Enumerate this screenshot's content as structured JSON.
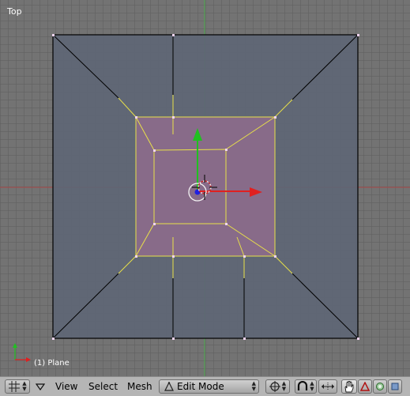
{
  "viewport": {
    "view_name": "Top",
    "object_label": "(1) Plane"
  },
  "header": {
    "menus": [
      {
        "key": "view",
        "label": "View"
      },
      {
        "key": "select",
        "label": "Select"
      },
      {
        "key": "mesh",
        "label": "Mesh"
      }
    ],
    "mode_label": "Edit Mode"
  },
  "colors": {
    "background": "#737373",
    "mesh_face": "#5e6675",
    "selected_face": "#8a6b8a",
    "selected_edge": "#e8e049",
    "vertex": "#f0d4f0",
    "x_axis": "#e02020",
    "y_axis": "#20c020",
    "header": "#b5b5b5"
  },
  "icons": [
    "viewport-type-icon",
    "header-collapse-icon",
    "mode-triangle-icon",
    "pivot-point-icon",
    "proportional-edit-icon",
    "snap-icon",
    "hand-icon",
    "vertex-select-icon",
    "face-select-icon",
    "occlude-icon"
  ]
}
